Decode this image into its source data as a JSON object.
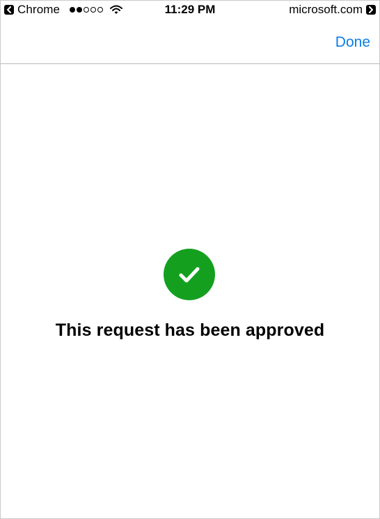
{
  "status_bar": {
    "back_app": "Chrome",
    "signal": {
      "filled": 2,
      "total": 5
    },
    "time": "11:29 PM",
    "site": "microsoft.com",
    "icons": [
      "back-chevron-icon",
      "signal-dots-icon",
      "wifi-icon",
      "forward-chevron-icon"
    ]
  },
  "nav": {
    "done_label": "Done"
  },
  "content": {
    "icon": "checkmark-circle-icon",
    "message": "This request has been approved"
  },
  "colors": {
    "accent_blue": "#0a7de8",
    "success_green": "#14a01e",
    "divider": "#b8b8b8"
  }
}
